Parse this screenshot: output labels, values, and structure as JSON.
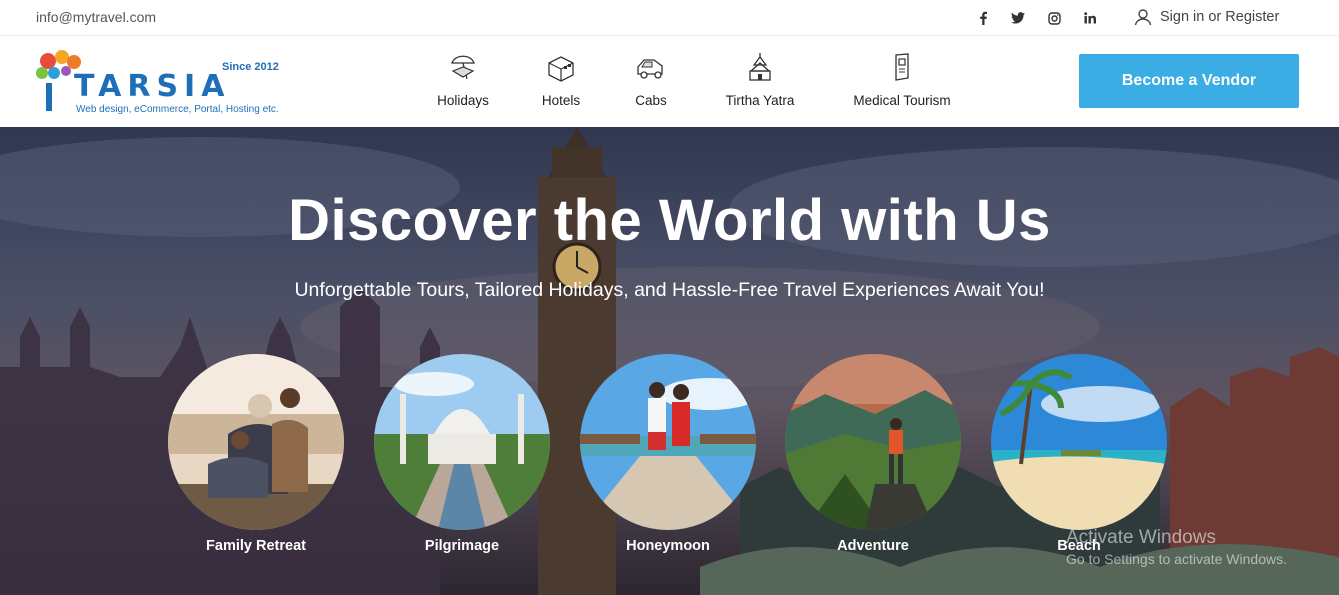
{
  "topbar": {
    "email": "info@mytravel.com",
    "social": [
      {
        "icon": "facebook-icon",
        "glyph": "f"
      },
      {
        "icon": "twitter-icon",
        "glyph": "t"
      },
      {
        "icon": "instagram-icon",
        "glyph": "◎"
      },
      {
        "icon": "linkedin-icon",
        "glyph": "in"
      }
    ],
    "signin_label": "Sign in or Register"
  },
  "logo": {
    "since": "Since 2012",
    "brand": "TARSIA",
    "tagline": "Web design, eCommerce, Portal, Hosting etc."
  },
  "nav": [
    {
      "label": "Holidays",
      "icon": "holidays-icon"
    },
    {
      "label": "Hotels",
      "icon": "hotels-icon"
    },
    {
      "label": "Cabs",
      "icon": "cabs-icon"
    },
    {
      "label": "Tirtha Yatra",
      "icon": "temple-icon"
    },
    {
      "label": "Medical Tourism",
      "icon": "medical-icon"
    }
  ],
  "vendor_button": "Become a Vendor",
  "hero": {
    "title": "Discover the World with Us",
    "subtitle": "Unforgettable Tours, Tailored Holidays, and Hassle-Free Travel Experiences Await You!"
  },
  "categories": [
    {
      "name": "Family Retreat"
    },
    {
      "name": "Pilgrimage"
    },
    {
      "name": "Honeymoon"
    },
    {
      "name": "Adventure"
    },
    {
      "name": "Beach"
    }
  ],
  "watermark": {
    "line1": "Activate Windows",
    "line2": "Go to Settings to activate Windows."
  },
  "colors": {
    "accent": "#3aaee4",
    "brand": "#1f6fb8"
  }
}
